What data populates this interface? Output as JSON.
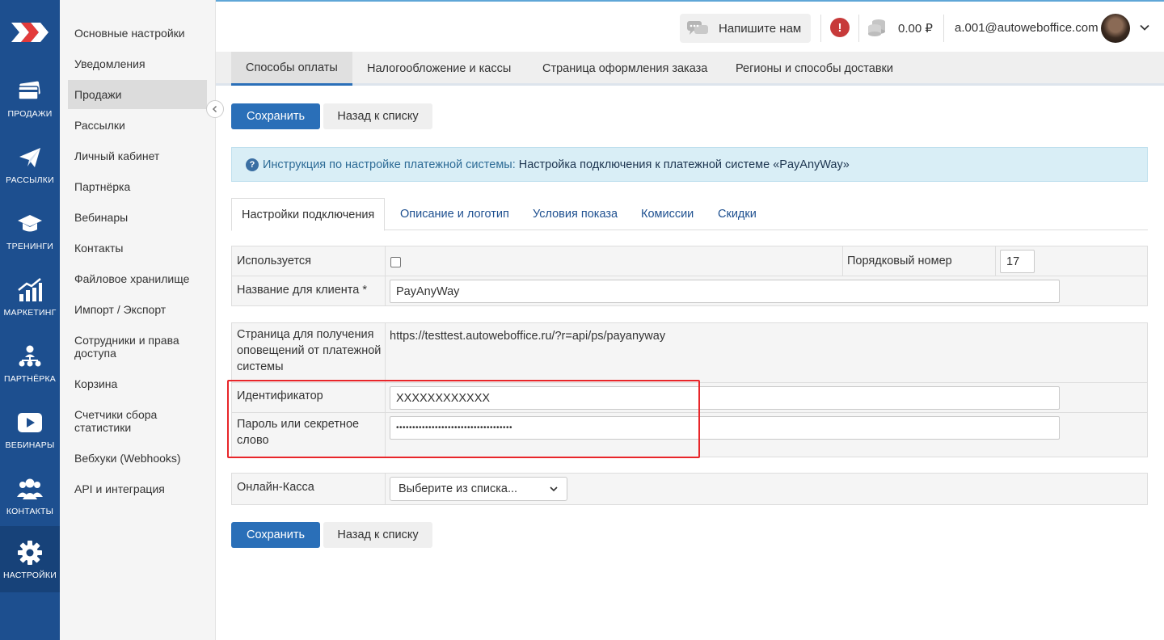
{
  "rail": {
    "items": [
      {
        "label": "ПРОДАЖИ",
        "icon": "card-icon"
      },
      {
        "label": "РАССЫЛКИ",
        "icon": "paper-plane-icon"
      },
      {
        "label": "ТРЕНИНГИ",
        "icon": "graduation-cap-icon"
      },
      {
        "label": "МАРКЕТИНГ",
        "icon": "chart-growth-icon"
      },
      {
        "label": "ПАРТНЁРКА",
        "icon": "network-icon"
      },
      {
        "label": "ВЕБИНАРЫ",
        "icon": "play-icon"
      },
      {
        "label": "КОНТАКТЫ",
        "icon": "users-icon"
      },
      {
        "label": "НАСТРОЙКИ",
        "icon": "gear-icon"
      }
    ]
  },
  "sidebar": {
    "items": [
      {
        "label": "Основные настройки"
      },
      {
        "label": "Уведомления"
      },
      {
        "label": "Продажи"
      },
      {
        "label": "Рассылки"
      },
      {
        "label": "Личный кабинет"
      },
      {
        "label": "Партнёрка"
      },
      {
        "label": "Вебинары"
      },
      {
        "label": "Контакты"
      },
      {
        "label": "Файловое хранилище"
      },
      {
        "label": "Импорт / Экспорт"
      },
      {
        "label": "Сотрудники и права доступа"
      },
      {
        "label": "Корзина"
      },
      {
        "label": "Счетчики сбора статистики"
      },
      {
        "label": "Вебхуки (Webhooks)"
      },
      {
        "label": "API и интеграция"
      }
    ]
  },
  "header": {
    "chat_label": "Напишите нам",
    "balance": "0.00 ₽",
    "email": "a.001@autoweboffice.com"
  },
  "tabs": [
    {
      "label": "Способы оплаты"
    },
    {
      "label": "Налогообложение и кассы"
    },
    {
      "label": "Страница оформления заказа"
    },
    {
      "label": "Регионы и способы доставки"
    }
  ],
  "buttons": {
    "save": "Сохранить",
    "back": "Назад к списку"
  },
  "info": {
    "prefix": "Инструкция по настройке платежной системы:",
    "link": "Настройка подключения к платежной системе «PayAnyWay»"
  },
  "subtabs": [
    {
      "label": "Настройки подключения"
    },
    {
      "label": "Описание и логотип"
    },
    {
      "label": "Условия показа"
    },
    {
      "label": "Комиссии"
    },
    {
      "label": "Скидки"
    }
  ],
  "form": {
    "used_label": "Используется",
    "order_label": "Порядковый номер",
    "order_value": "17",
    "client_name_label": "Название для клиента *",
    "client_name_value": "PayAnyWay",
    "notify_label": "Страница для получения оповещений от платежной системы",
    "notify_url": "https://testtest.autoweboffice.ru/?r=api/ps/payanyway",
    "id_label": "Идентификатор",
    "id_value": "XXXXXXXXXXXX",
    "password_label": "Пароль или секретное слово",
    "password_value": "••••••••••••••••••••••••••••••••••••",
    "kassa_label": "Онлайн-Касса",
    "kassa_selected": "Выберите из списка..."
  },
  "colors": {
    "rail": "#1d4f8f",
    "primary": "#2a6fb8",
    "highlight": "#e8262a"
  }
}
